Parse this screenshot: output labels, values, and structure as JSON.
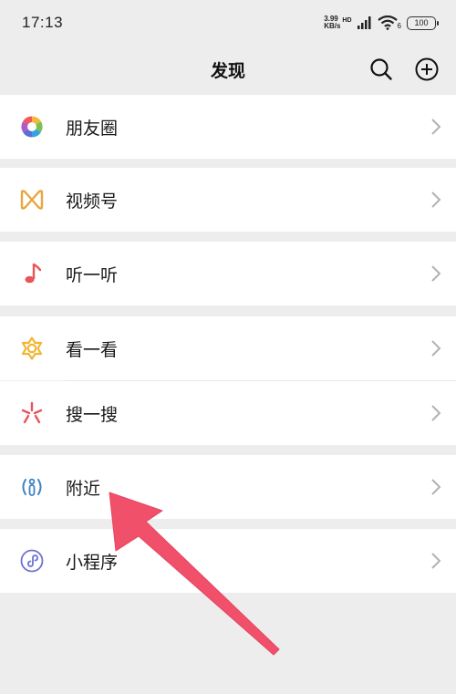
{
  "status": {
    "time": "17:13",
    "speed_value": "3.99",
    "speed_unit": "KB/s",
    "network": "HD",
    "wifi_suffix": "6",
    "battery": "100"
  },
  "header": {
    "title": "发现"
  },
  "menu": [
    {
      "label": "朋友圈",
      "icon": "moments-icon"
    },
    {
      "label": "视频号",
      "icon": "channels-icon"
    },
    {
      "label": "听一听",
      "icon": "music-note-icon"
    },
    {
      "label": "看一看",
      "icon": "top-stories-icon"
    },
    {
      "label": "搜一搜",
      "icon": "search-star-icon"
    },
    {
      "label": "附近",
      "icon": "nearby-icon"
    },
    {
      "label": "小程序",
      "icon": "mini-program-icon"
    }
  ],
  "colors": {
    "background": "#ededed",
    "row": "#ffffff",
    "annotation_arrow": "#f0506a"
  }
}
